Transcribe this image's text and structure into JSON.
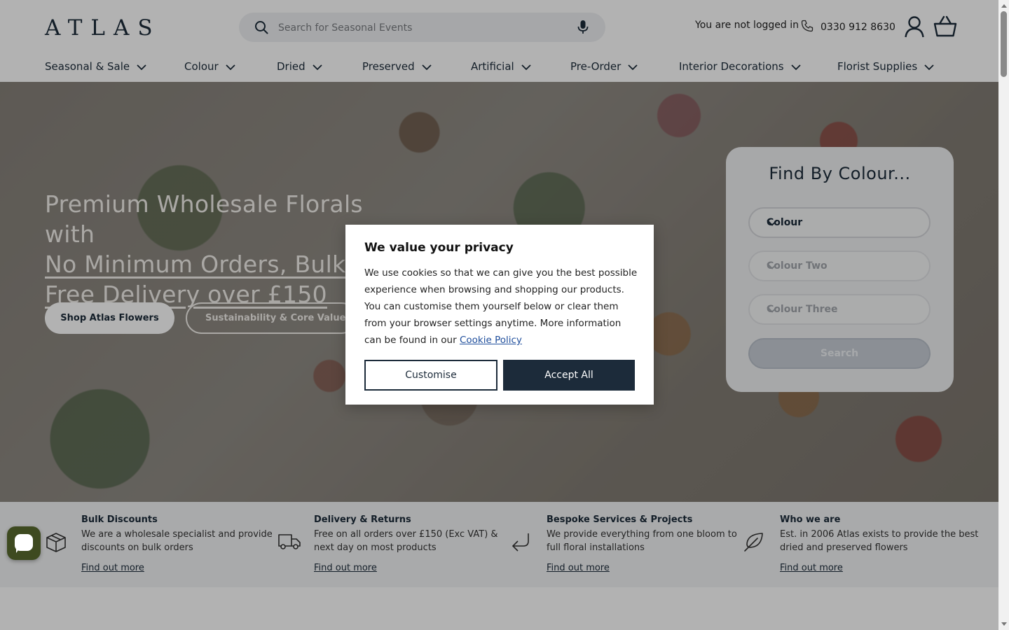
{
  "header": {
    "logo": "ATLAS",
    "search_placeholder": "Search for Seasonal Events",
    "login_status": "You are not logged in",
    "phone": "0330 912 8630"
  },
  "nav": {
    "items": [
      {
        "label": "Seasonal & Sale"
      },
      {
        "label": "Colour"
      },
      {
        "label": "Dried"
      },
      {
        "label": "Preserved"
      },
      {
        "label": "Artificial"
      },
      {
        "label": "Pre-Order"
      },
      {
        "label": "Interior Decorations"
      },
      {
        "label": "Florist Supplies"
      }
    ]
  },
  "hero": {
    "title_line1": "Premium Wholesale Florals with",
    "title_line2": "No Minimum Orders, Bulk D",
    "title_line3": "Free Delivery over £150",
    "primary_button": "Shop Atlas Flowers",
    "secondary_button": "Sustainability & Core Values"
  },
  "colour_finder": {
    "title": "Find By Colour...",
    "select1": "Colour",
    "select2": "Colour Two",
    "select3": "Colour Three",
    "search_button": "Search"
  },
  "features": [
    {
      "title": "Bulk Discounts",
      "text": "We are a wholesale specialist and provide discounts on bulk orders",
      "link": "Find out more",
      "icon": "box-icon"
    },
    {
      "title": "Delivery & Returns",
      "text": "Free on all orders over £150 (Exc VAT) & next day on most products",
      "link": "Find out more",
      "icon": "truck-icon"
    },
    {
      "title": "Bespoke Services & Projects",
      "text": "We provide everything from one bloom to full floral installations",
      "link": "Find out more",
      "icon": "return-arrow-icon"
    },
    {
      "title": "Who we are",
      "text": "Est. in 2006 Atlas exists to provide the best dried and preserved flowers",
      "link": "Find out more",
      "icon": "leaf-icon"
    }
  ],
  "cookie_modal": {
    "title": "We value your privacy",
    "body": "We use cookies so that we can give you the best possible experience when browsing and shopping our products. You can customise them yourself below or clear them from your browser settings anytime. More information can be found in our",
    "policy_link": "Cookie Policy",
    "customise_button": "Customise",
    "accept_button": "Accept All"
  },
  "colors": {
    "brand_navy": "#1c2b3a",
    "chat_green": "#3e4a20",
    "link_blue": "#1f4e9c"
  }
}
